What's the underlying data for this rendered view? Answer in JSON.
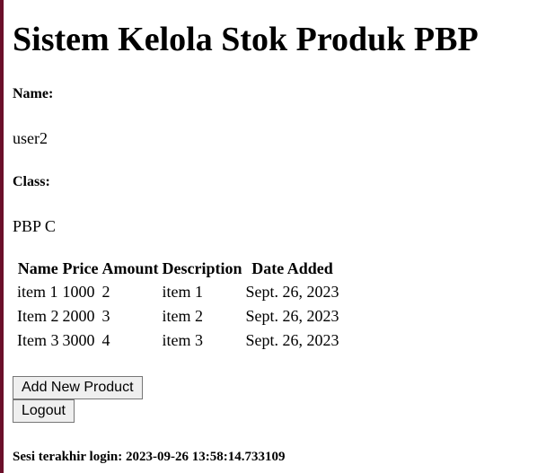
{
  "page": {
    "title": "Sistem Kelola Stok Produk PBP"
  },
  "profile": {
    "name_label": "Name:",
    "name_value": "user2",
    "class_label": "Class:",
    "class_value": "PBP C"
  },
  "table": {
    "headers": [
      "Name",
      "Price",
      "Amount",
      "Description",
      "Date Added"
    ],
    "rows": [
      [
        "item 1",
        "1000",
        "2",
        "item 1",
        "Sept. 26, 2023"
      ],
      [
        "Item 2",
        "2000",
        "3",
        "item 2",
        "Sept. 26, 2023"
      ],
      [
        "Item 3",
        "3000",
        "4",
        "item 3",
        "Sept. 26, 2023"
      ]
    ]
  },
  "actions": {
    "add_label": "Add New Product",
    "logout_label": "Logout"
  },
  "footer": {
    "last_login": "Sesi terakhir login: 2023-09-26 13:58:14.733109"
  },
  "colors": {
    "left_edge": "#6b0f2a",
    "button_bg": "#efefef",
    "button_border": "#767676"
  }
}
